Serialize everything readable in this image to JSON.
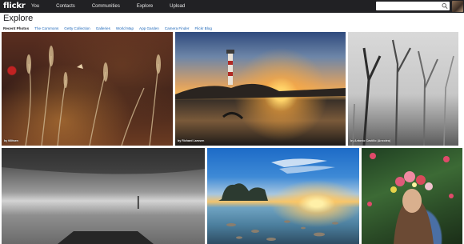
{
  "topbar": {
    "logo": "flickr",
    "nav": [
      "You",
      "Contacts",
      "Communities",
      "Explore",
      "Upload"
    ],
    "search_placeholder": ""
  },
  "header": {
    "title": "Explore",
    "subnav": [
      "Recent Photos",
      "The Commons",
      "Getty Collection",
      "Galleries",
      "World Map",
      "App Garden",
      "Camera Finder",
      "Flickr Blog"
    ]
  },
  "photos": [
    {
      "credit": "by tillitsen"
    },
    {
      "credit": "by Richard Larssen"
    },
    {
      "credit": "by Antonio Castillo (Anxoleo)"
    },
    {
      "credit": ""
    },
    {
      "credit": ""
    },
    {
      "credit": ""
    }
  ]
}
